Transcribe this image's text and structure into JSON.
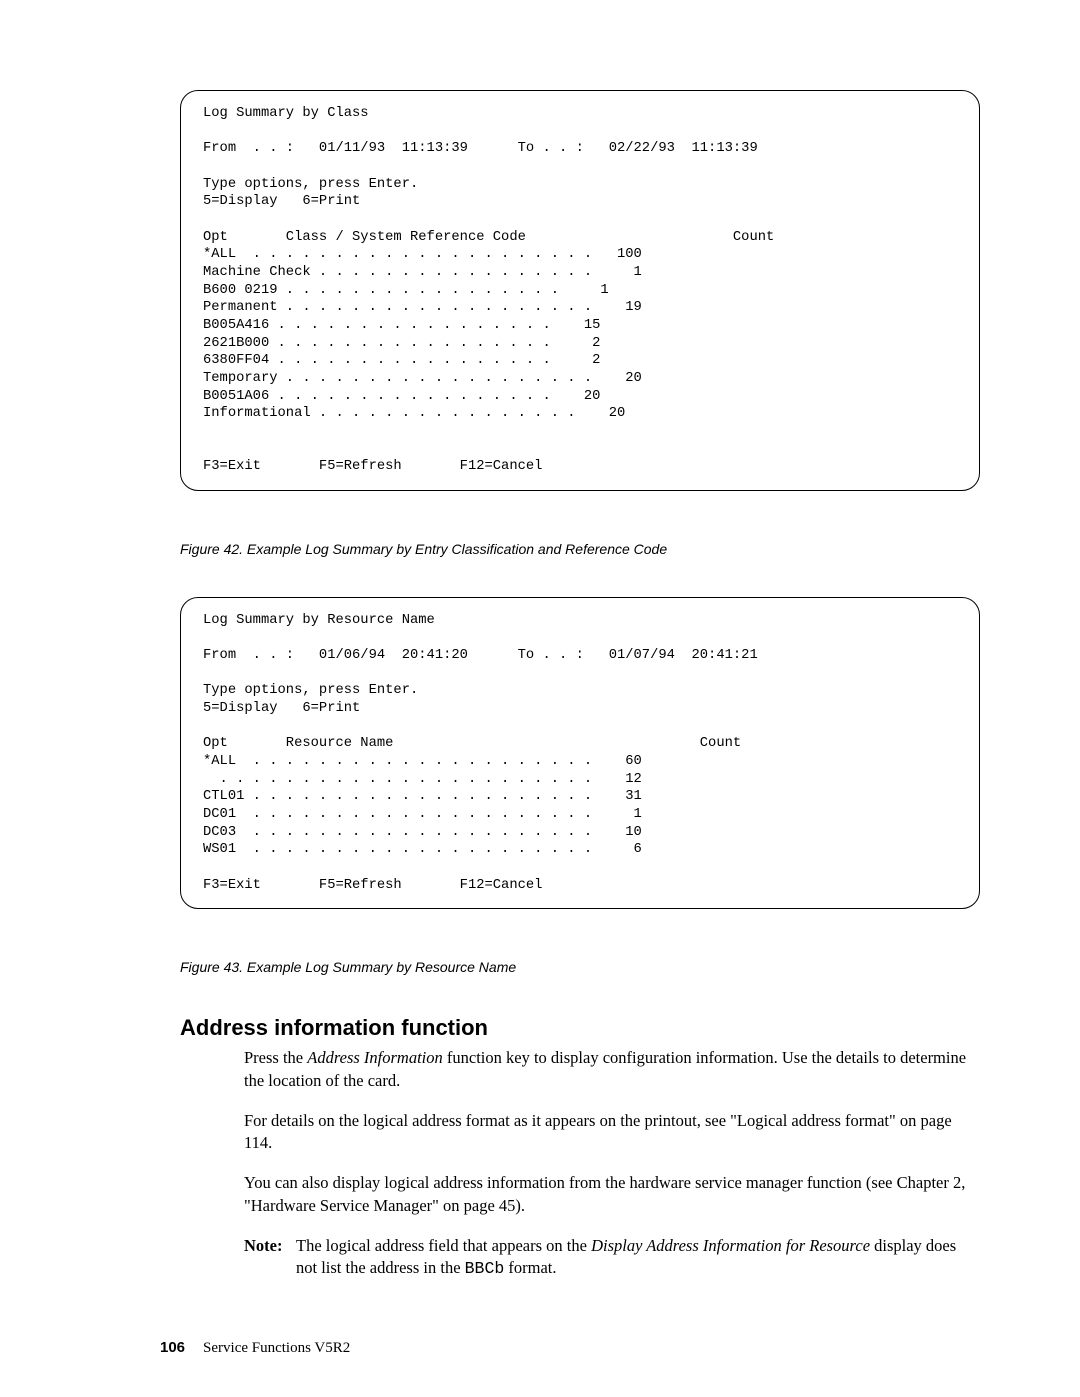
{
  "screen1": {
    "title": "Log Summary by Class",
    "range": "From  . . :   01/11/93  11:13:39      To . . :   02/22/93  11:13:39",
    "options_line1": "Type options, press Enter.",
    "options_line2": "5=Display   6=Print",
    "header": "Opt       Class / System Reference Code                         Count",
    "rows": [
      "*ALL  . . . . . . . . . . . . . . . . . . . . .   100",
      "Machine Check . . . . . . . . . . . . . . . . .     1",
      "B600 0219 . . . . . . . . . . . . . . . . .     1",
      "Permanent . . . . . . . . . . . . . . . . . . .    19",
      "B005A416 . . . . . . . . . . . . . . . . .    15",
      "2621B000 . . . . . . . . . . . . . . . . .     2",
      "6380FF04 . . . . . . . . . . . . . . . . .     2",
      "Temporary . . . . . . . . . . . . . . . . . . .    20",
      "B0051A06 . . . . . . . . . . . . . . . . .    20",
      "Informational . . . . . . . . . . . . . . . .    20"
    ],
    "fkeys": "F3=Exit       F5=Refresh       F12=Cancel"
  },
  "figure42": "Figure 42. Example Log Summary by Entry Classification and Reference Code",
  "screen2": {
    "title": "Log Summary by Resource Name",
    "range": "From  . . :   01/06/94  20:41:20      To . . :   01/07/94  20:41:21",
    "options_line1": "Type options, press Enter.",
    "options_line2": "5=Display   6=Print",
    "header": "Opt       Resource Name                                     Count",
    "rows": [
      "*ALL  . . . . . . . . . . . . . . . . . . . . .    60",
      "  . . . . . . . . . . . . . . . . . . . . . . .    12",
      "CTL01 . . . . . . . . . . . . . . . . . . . . .    31",
      "DC01  . . . . . . . . . . . . . . . . . . . . .     1",
      "DC03  . . . . . . . . . . . . . . . . . . . . .    10",
      "WS01  . . . . . . . . . . . . . . . . . . . . .     6"
    ],
    "fkeys": "F3=Exit       F5=Refresh       F12=Cancel"
  },
  "figure43": "Figure 43. Example Log Summary by Resource Name",
  "section_heading": "Address information function",
  "para1_a": "Press the ",
  "para1_i": "Address Information",
  "para1_b": " function key to display configuration information. Use the details to determine the location of the card.",
  "para2": "For details on the logical address format as it appears on the printout, see \"Logical address format\" on page 114.",
  "para3": "You can also display logical address information from the hardware service manager function (see Chapter 2, \"Hardware Service Manager\" on page 45).",
  "note_label": "Note:",
  "note_a": "The logical address field that appears on the ",
  "note_i": "Display Address Information for Resource",
  "note_b": " display does not list the address in the ",
  "note_mono": "BBCb",
  "note_c": " format.",
  "footer_page": "106",
  "footer_text": "Service Functions V5R2"
}
